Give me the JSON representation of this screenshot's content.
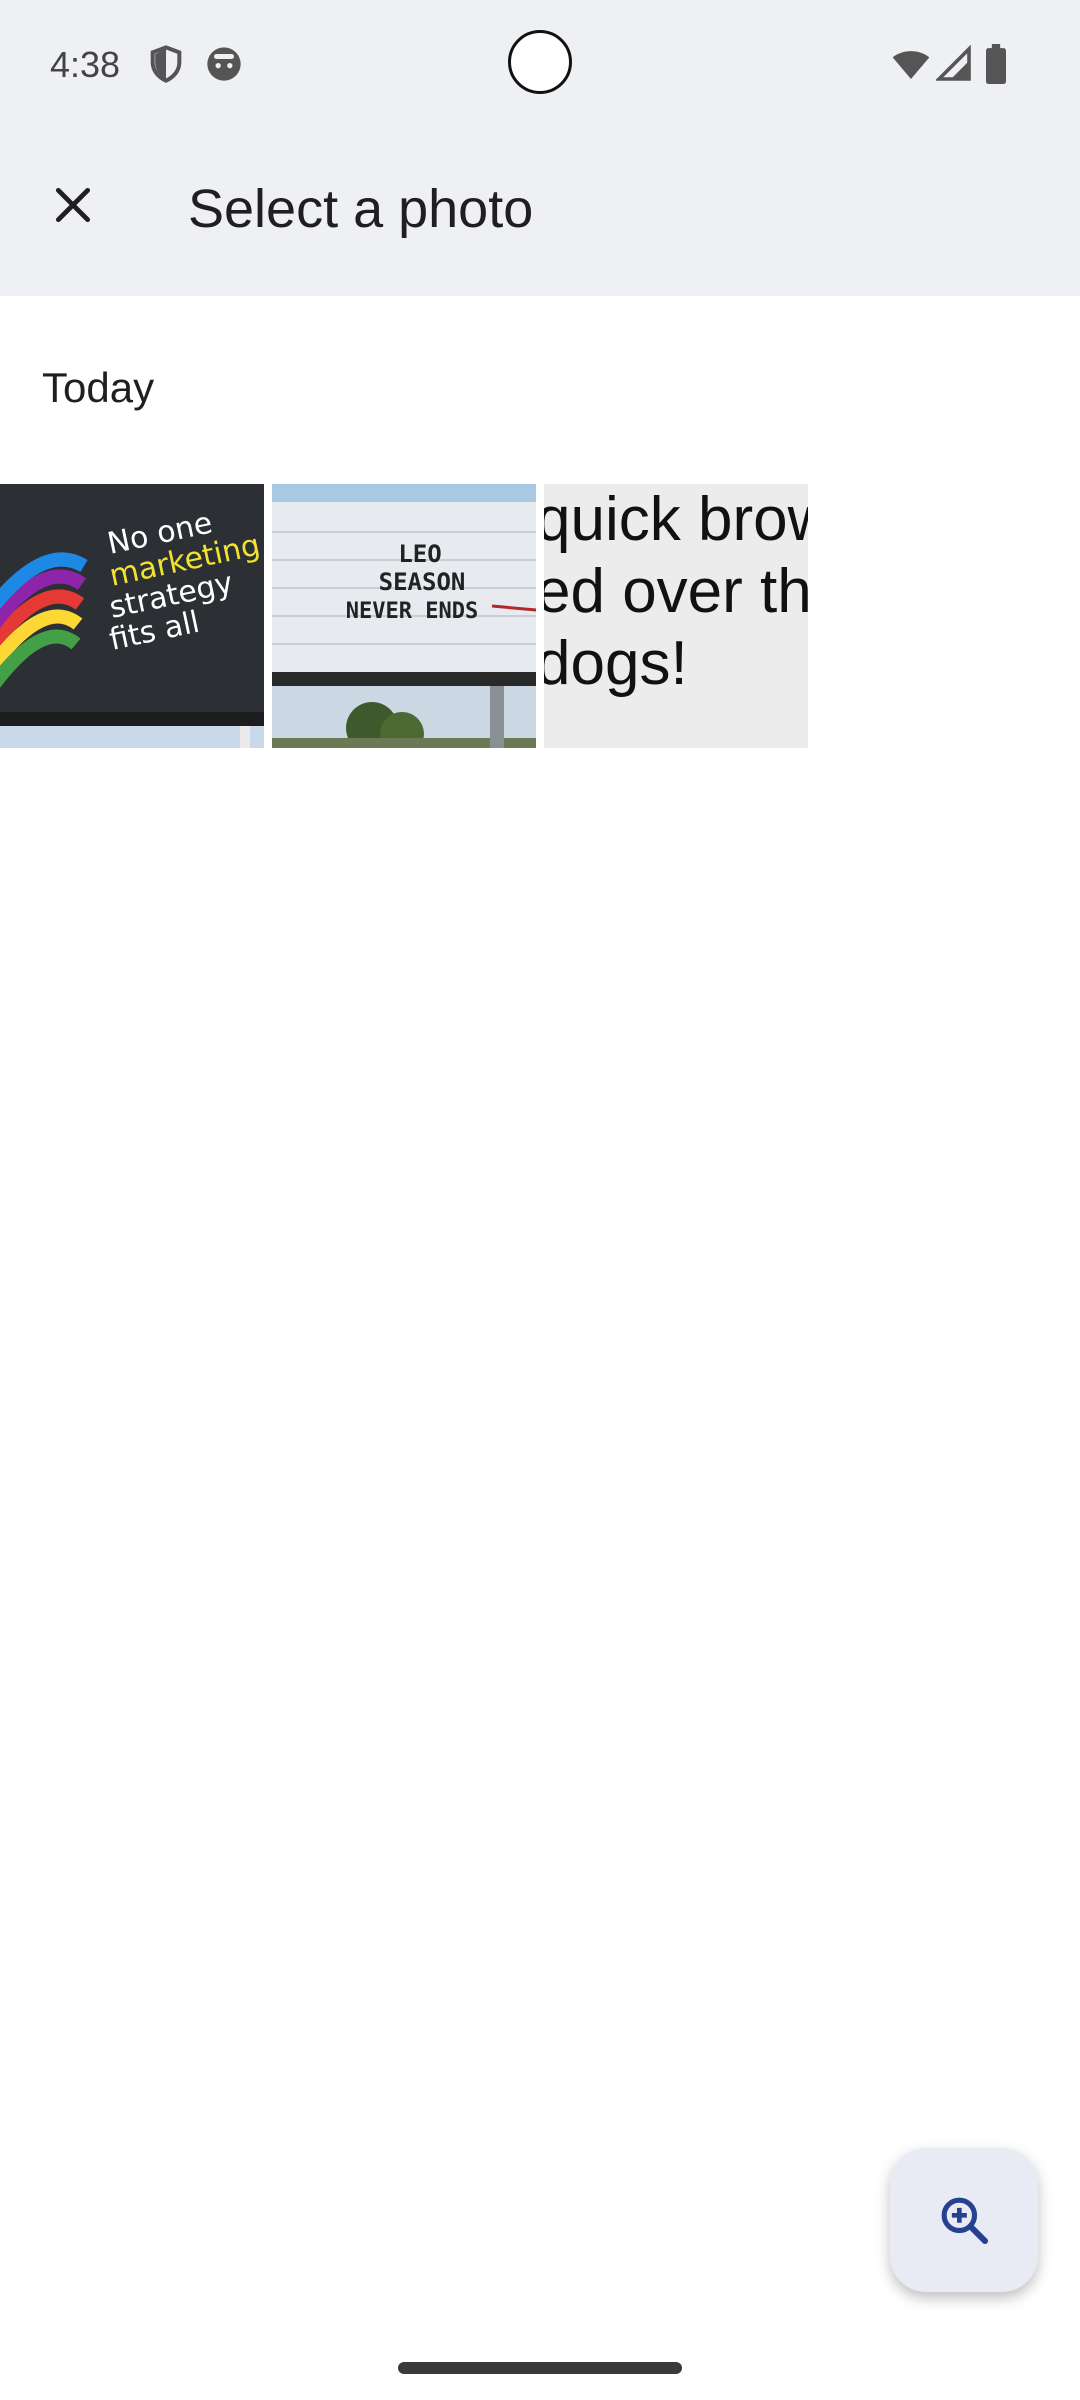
{
  "status_bar": {
    "time": "4:38",
    "left_icons": [
      "shield-icon",
      "android-bot-icon"
    ],
    "right_icons": [
      "wifi-icon",
      "cell-signal-icon",
      "battery-icon"
    ]
  },
  "app_bar": {
    "title": "Select a photo",
    "close_icon": "close-icon"
  },
  "section": {
    "title": "Today"
  },
  "photos": [
    {
      "lines": [
        "No one",
        "marketing",
        "strategy",
        "fits all"
      ]
    },
    {
      "lines": [
        "LEO",
        "SEASON",
        "NEVER ENDS"
      ]
    },
    {
      "lines": [
        "quick brow",
        "ed over th",
        "dogs!"
      ]
    }
  ],
  "fab": {
    "icon": "zoom-in-icon"
  },
  "colors": {
    "surface": "#eef0f4",
    "fab_bg": "#e8ebf3",
    "fab_icon": "#26418f"
  }
}
